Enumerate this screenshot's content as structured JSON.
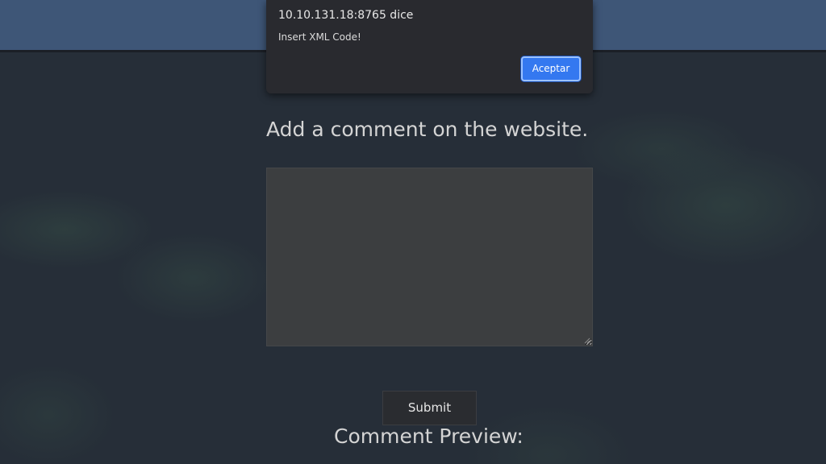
{
  "dialog": {
    "origin": "10.10.131.18:8765 dice",
    "message": "Insert XML Code!",
    "ok_label": "Aceptar"
  },
  "form": {
    "heading": "Add a comment on the website.",
    "comment_value": "",
    "submit_label": "Submit"
  },
  "preview": {
    "heading": "Comment Preview:"
  },
  "colors": {
    "header": "#3e5677",
    "background": "#262e38",
    "textarea": "#3c3e40",
    "dialog": "#292a2f",
    "accent": "#3478f0"
  }
}
